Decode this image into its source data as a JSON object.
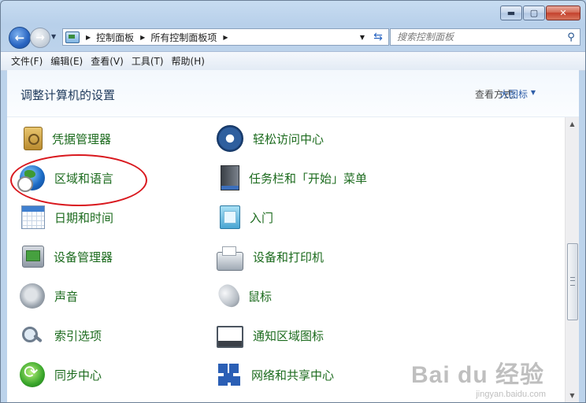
{
  "window": {
    "minimize": "▬",
    "maximize": "▢",
    "close": "✕"
  },
  "nav": {
    "back_glyph": "←",
    "forward_glyph": "→",
    "breadcrumb": [
      "控制面板",
      "所有控制面板项"
    ],
    "search_placeholder": "搜索控制面板"
  },
  "menu": [
    "文件(F)",
    "编辑(E)",
    "查看(V)",
    "工具(T)",
    "帮助(H)"
  ],
  "header": {
    "title": "调整计算机的设置",
    "view_by_label": "查看方式:",
    "view_by_value": "大图标"
  },
  "items": {
    "left": [
      {
        "label": "凭据管理器",
        "icon": "credential-vault-icon"
      },
      {
        "label": "区域和语言",
        "icon": "globe-clock-icon"
      },
      {
        "label": "日期和时间",
        "icon": "calendar-clock-icon"
      },
      {
        "label": "设备管理器",
        "icon": "device-manager-icon"
      },
      {
        "label": "声音",
        "icon": "speaker-icon"
      },
      {
        "label": "索引选项",
        "icon": "magnifier-icon"
      },
      {
        "label": "同步中心",
        "icon": "sync-icon"
      }
    ],
    "right": [
      {
        "label": "轻松访问中心",
        "icon": "ease-of-access-icon"
      },
      {
        "label": "任务栏和「开始」菜单",
        "icon": "taskbar-icon"
      },
      {
        "label": "入门",
        "icon": "getting-started-icon"
      },
      {
        "label": "设备和打印机",
        "icon": "printer-icon"
      },
      {
        "label": "鼠标",
        "icon": "mouse-icon"
      },
      {
        "label": "通知区域图标",
        "icon": "notification-area-icon"
      },
      {
        "label": "网络和共享中心",
        "icon": "network-icon"
      }
    ]
  },
  "highlight": {
    "target": "区域和语言",
    "color": "#d9181e"
  },
  "watermark": {
    "text": "Bai du 经验",
    "sub": "jingyan.baidu.com"
  },
  "colors": {
    "link_green": "#1c6b1e",
    "title_blue": "#1e395b",
    "accent_blue": "#2f5ea8"
  }
}
